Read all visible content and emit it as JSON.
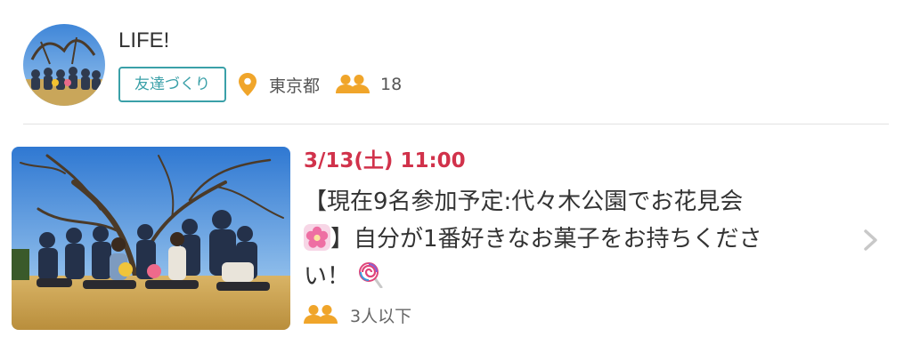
{
  "group": {
    "name": "LIFE!",
    "category": "友達づくり",
    "location": "東京都",
    "member_count": "18",
    "avatar_icon": "group-photo",
    "pin_icon": "location-pin-icon",
    "members_icon": "people-icon"
  },
  "event": {
    "date": "3/13(土) 11:00",
    "title_part1": "【現在9名参加予定:代々木公園でお花見会",
    "title_part2": "】自分が1番好きなお菓子をお持ちくださ",
    "title_part3": "い！",
    "flower_emoji_icon": "cherry-blossom-icon",
    "lollipop_emoji_icon": "lollipop-icon",
    "attendance": "3人以下",
    "chevron_icon": "chevron-right-icon"
  },
  "colors": {
    "accent_teal": "#3aa0a8",
    "date_red": "#d1324b",
    "icon_orange": "#f0a52a",
    "divider": "#e2e2e2"
  }
}
